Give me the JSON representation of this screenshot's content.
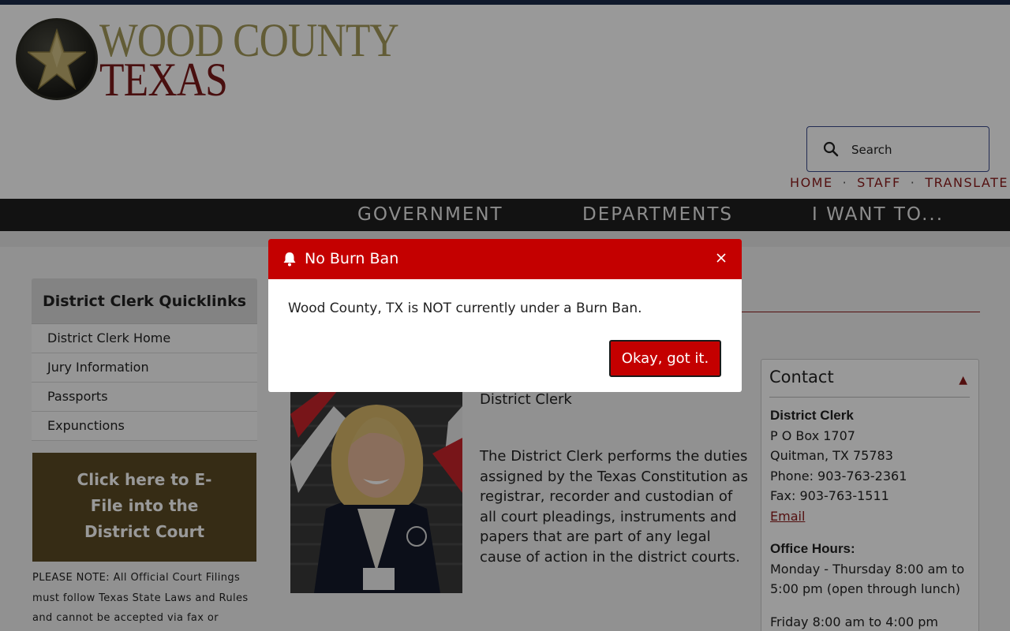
{
  "brand": {
    "line1": "WOOD COUNTY",
    "line2": "TEXAS"
  },
  "search": {
    "placeholder": "Search"
  },
  "utility_links": [
    {
      "label": "HOME"
    },
    {
      "label": "STAFF"
    },
    {
      "label": "TRANSLATE"
    }
  ],
  "utility_separator": "·",
  "nav": [
    {
      "label": "GOVERNMENT"
    },
    {
      "label": "DEPARTMENTS"
    },
    {
      "label": "I WANT TO..."
    }
  ],
  "quicklinks": {
    "title": "District Clerk Quicklinks",
    "items": [
      {
        "label": "District Clerk Home"
      },
      {
        "label": "Jury Information"
      },
      {
        "label": "Passports"
      },
      {
        "label": "Expunctions"
      }
    ]
  },
  "efile": {
    "label": "Click here to E-File into the District Court"
  },
  "note": {
    "text": "PLEASE NOTE: All Official Court Filings must follow Texas State Laws and Rules and cannot be accepted via fax or"
  },
  "main": {
    "role": "District Clerk",
    "description": "The District Clerk performs the duties assigned by the Texas Constitution as registrar, recorder and custodian of all court pleadings, instruments and papers that are part of any legal cause of action in the district courts."
  },
  "contact": {
    "title": "Contact",
    "toggle_icon": "triangle-up-icon",
    "name": "District Clerk",
    "address1": "P O Box 1707",
    "address2": "Quitman, TX 75783",
    "phone": "Phone: 903-763-2361",
    "fax": "Fax: 903-763-1511",
    "email_label": "Email",
    "hours_title": "Office Hours:",
    "hours1": "Monday - Thursday 8:00 am to 5:00 pm (open through lunch)",
    "hours2": "Friday 8:00 am to 4:00 pm"
  },
  "modal": {
    "title": "No Burn Ban",
    "message": "Wood County, TX is NOT currently under a Burn Ban.",
    "button": "Okay, got it.",
    "icon": "bell-icon"
  },
  "colors": {
    "accent_red": "#c40000",
    "brand_maroon": "#8b1a1a",
    "brand_gold": "#a39a5a",
    "nav_bg": "#1e1e1e",
    "efile_bg": "#5a4a24"
  }
}
